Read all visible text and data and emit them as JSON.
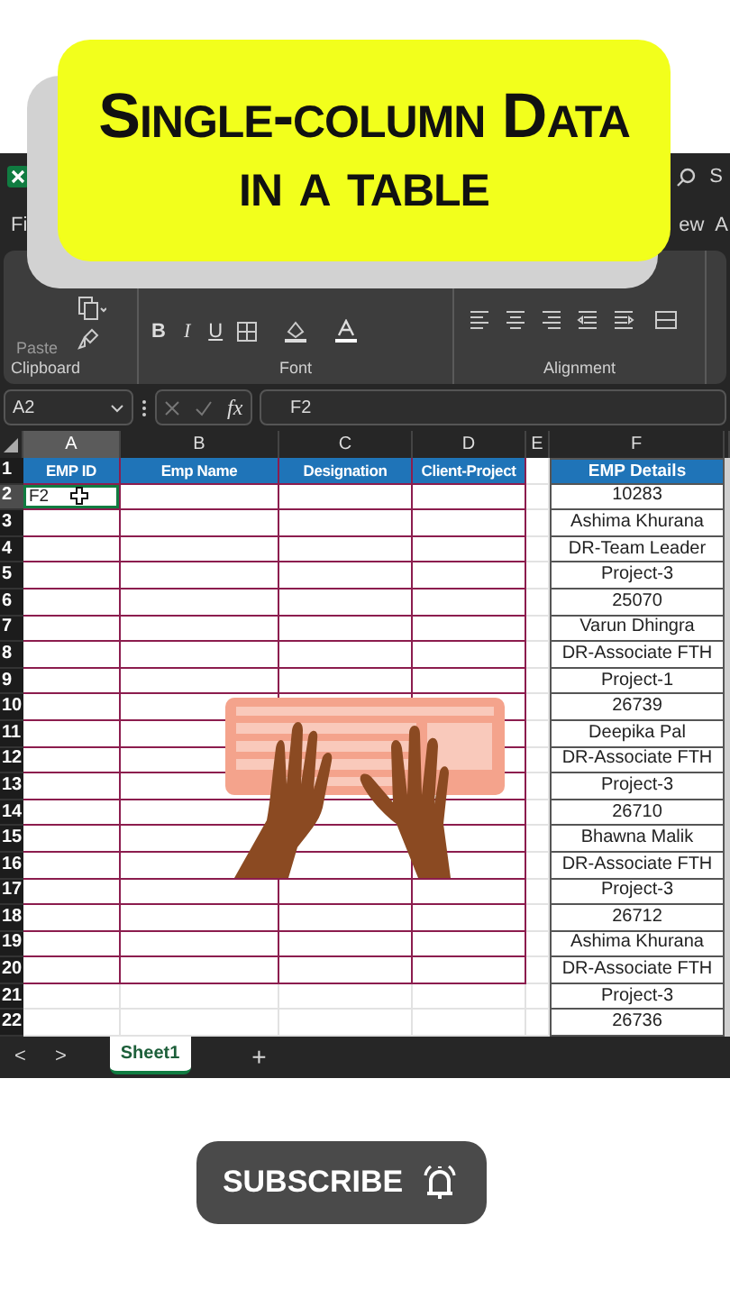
{
  "banner": {
    "title": "Single-column Data in a table"
  },
  "title_bar": {
    "search": "S"
  },
  "menu_tabs": [
    {
      "label": "Fi"
    },
    {
      "label": "ew"
    },
    {
      "label": "A"
    }
  ],
  "ribbon": {
    "paste": "Paste",
    "font_buttons": [
      "B",
      "I",
      "U"
    ],
    "groups": [
      "Clipboard",
      "Font",
      "Alignment"
    ]
  },
  "formula_bar": {
    "name_box": "A2",
    "function_label": "fx",
    "formula": "F2"
  },
  "columns": [
    {
      "letter": "A",
      "selected": true
    },
    {
      "letter": "B",
      "selected": false
    },
    {
      "letter": "C",
      "selected": false
    },
    {
      "letter": "D",
      "selected": false
    },
    {
      "letter": "E",
      "selected": false
    },
    {
      "letter": "F",
      "selected": false
    }
  ],
  "rows": [
    {
      "number": "1",
      "selected": false,
      "kind": "header",
      "a": "EMP ID",
      "b": "Emp Name",
      "c": "Designation",
      "d": "Client-Project",
      "f": "EMP Details"
    },
    {
      "number": "2",
      "selected": true,
      "kind": "table",
      "a": "F2",
      "f": "10283"
    },
    {
      "number": "3",
      "selected": false,
      "kind": "table",
      "f": "Ashima Khurana"
    },
    {
      "number": "4",
      "selected": false,
      "kind": "table",
      "f": "DR-Team Leader"
    },
    {
      "number": "5",
      "selected": false,
      "kind": "table",
      "f": "Project-3"
    },
    {
      "number": "6",
      "selected": false,
      "kind": "table",
      "f": "25070"
    },
    {
      "number": "7",
      "selected": false,
      "kind": "table",
      "f": "Varun Dhingra"
    },
    {
      "number": "8",
      "selected": false,
      "kind": "table",
      "f": "DR-Associate FTH"
    },
    {
      "number": "9",
      "selected": false,
      "kind": "table",
      "f": "Project-1"
    },
    {
      "number": "10",
      "selected": false,
      "kind": "table",
      "f": "26739"
    },
    {
      "number": "11",
      "selected": false,
      "kind": "table",
      "f": "Deepika Pal"
    },
    {
      "number": "12",
      "selected": false,
      "kind": "table",
      "f": "DR-Associate FTH"
    },
    {
      "number": "13",
      "selected": false,
      "kind": "table",
      "f": "Project-3"
    },
    {
      "number": "14",
      "selected": false,
      "kind": "table",
      "f": "26710"
    },
    {
      "number": "15",
      "selected": false,
      "kind": "table",
      "f": "Bhawna Malik"
    },
    {
      "number": "16",
      "selected": false,
      "kind": "table",
      "f": "DR-Associate FTH"
    },
    {
      "number": "17",
      "selected": false,
      "kind": "table",
      "f": "Project-3"
    },
    {
      "number": "18",
      "selected": false,
      "kind": "table",
      "f": "26712"
    },
    {
      "number": "19",
      "selected": false,
      "kind": "table",
      "f": "Ashima Khurana"
    },
    {
      "number": "20",
      "selected": false,
      "kind": "table",
      "f": "DR-Associate FTH"
    },
    {
      "number": "21",
      "selected": false,
      "kind": "plain",
      "f": "Project-3"
    },
    {
      "number": "22",
      "selected": false,
      "kind": "plain",
      "f": "26736"
    }
  ],
  "sheet_bar": {
    "prev": "<",
    "next": ">",
    "tabs": [
      {
        "label": "Sheet1",
        "selected": true
      }
    ],
    "add": "+"
  },
  "subscribe": {
    "label": "SUBSCRIBE"
  }
}
